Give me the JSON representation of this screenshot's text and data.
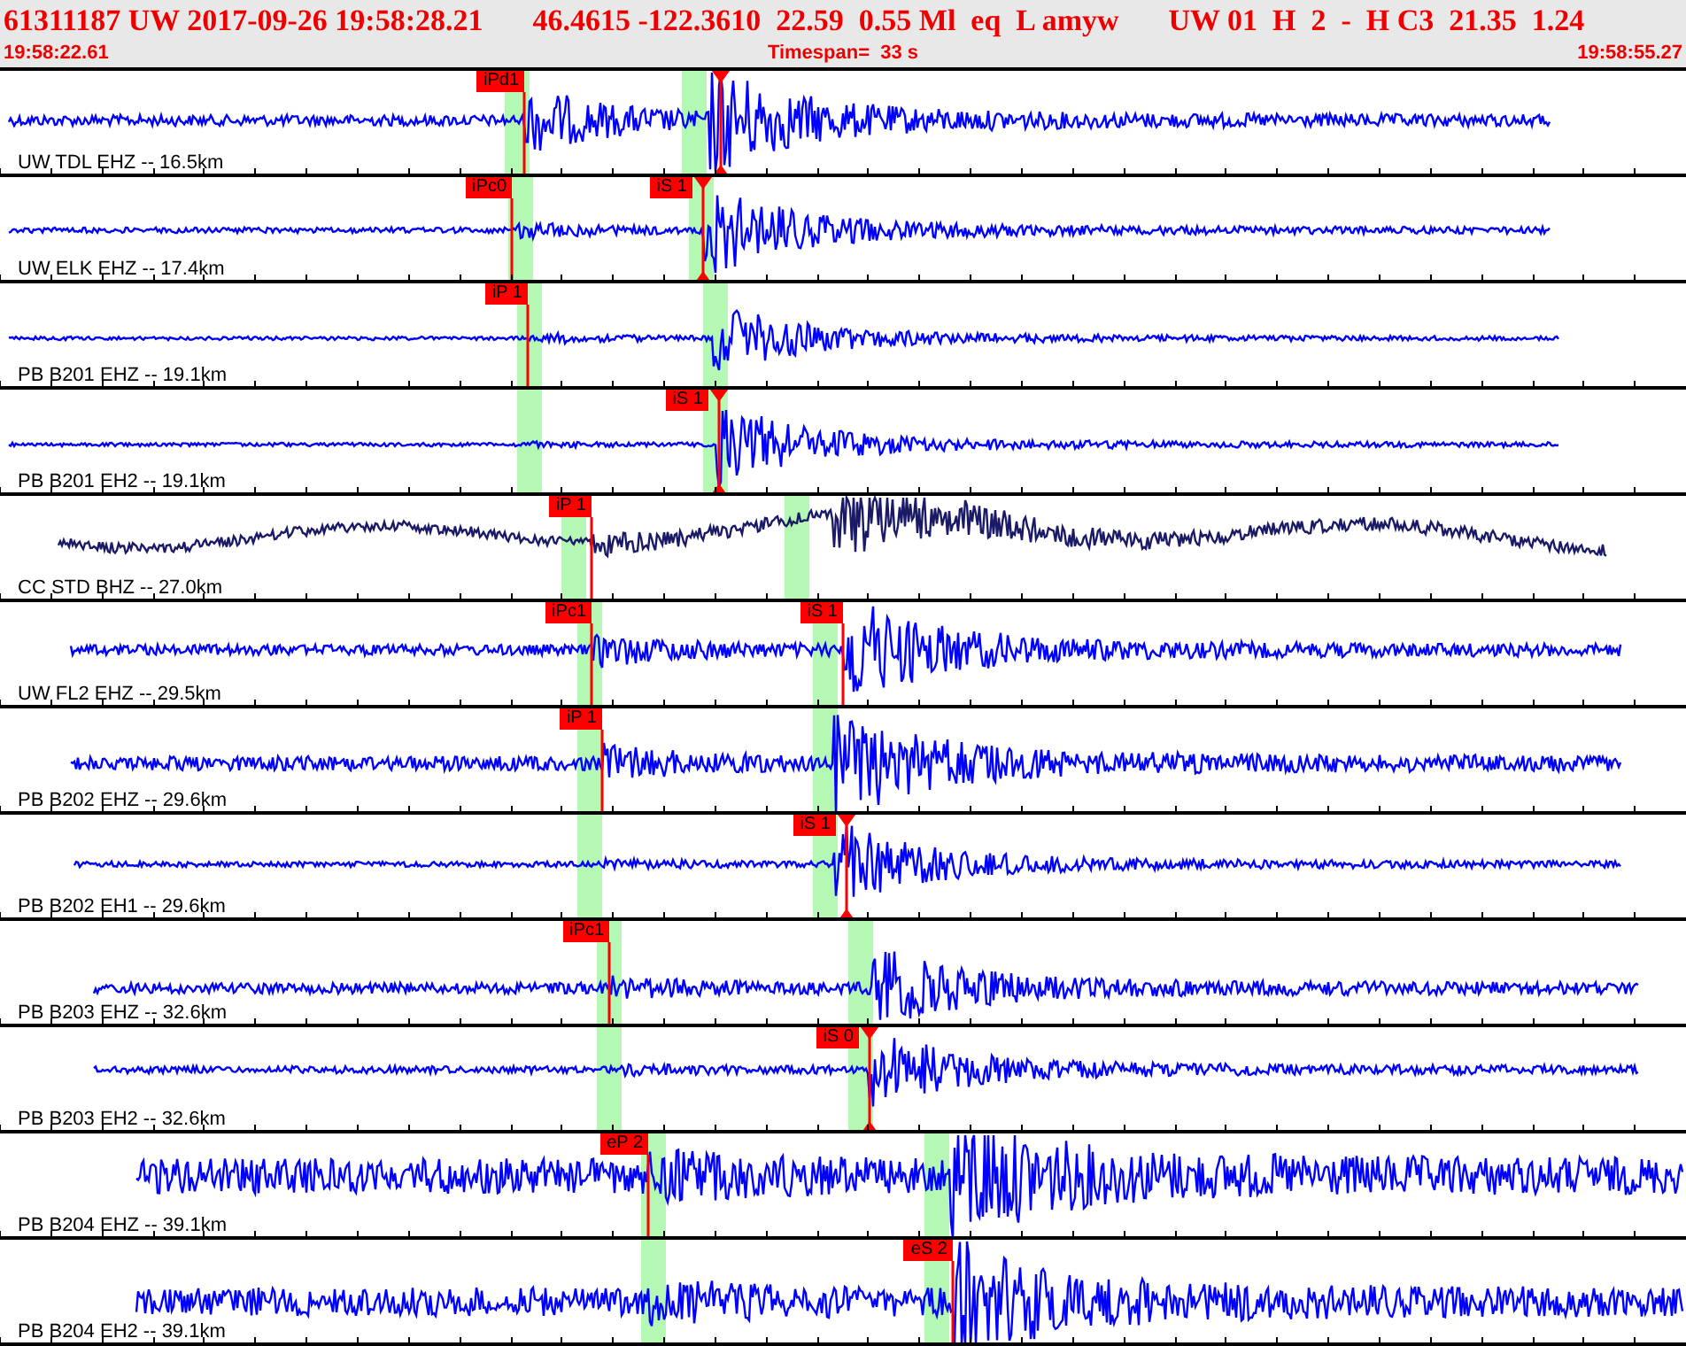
{
  "header": {
    "title_parts": [
      "61311187 UW 2017-09-26 19:58:28.21",
      "46.4615 -122.3610  22.59  0.55 Ml  eq  L amyw",
      "UW 01  H  2  -  H C3  21.35  1.24"
    ],
    "start_time": "19:58:22.61",
    "timespan": "Timespan=  33 s",
    "end_time": "19:58:55.27"
  },
  "traces": [
    {
      "label": "UW TDL EHZ -- 16.5km",
      "color": "#0000ff",
      "picks": [
        {
          "label": "iPd1",
          "selected": false
        },
        {
          "selected": true
        }
      ]
    },
    {
      "label": "UW ELK EHZ -- 17.4km",
      "color": "#0000ff",
      "picks": [
        {
          "label": "iPc0",
          "selected": false
        },
        {
          "label": "iS 1",
          "selected": true
        }
      ]
    },
    {
      "label": "PB B201 EHZ -- 19.1km",
      "color": "#0000ff",
      "picks": [
        {
          "label": "iP 1",
          "selected": false
        }
      ]
    },
    {
      "label": "PB B201 EH2 -- 19.1km",
      "color": "#0000ff",
      "picks": [
        {
          "label": "iS 1",
          "selected": true
        }
      ]
    },
    {
      "label": "CC STD BHZ -- 27.0km",
      "color": "#1a1a66",
      "picks": [
        {
          "label": "iP 1",
          "selected": false
        }
      ]
    },
    {
      "label": "UW FL2 EHZ -- 29.5km",
      "color": "#0000ff",
      "picks": [
        {
          "label": "iPc1",
          "selected": false
        },
        {
          "label": "iS 1",
          "selected": false
        }
      ]
    },
    {
      "label": "PB B202 EHZ -- 29.6km",
      "color": "#0000ff",
      "picks": [
        {
          "label": "iP 1",
          "selected": false
        }
      ]
    },
    {
      "label": "PB B202 EH1 -- 29.6km",
      "color": "#0000ff",
      "picks": [
        {
          "label": "iS 1",
          "selected": true
        }
      ]
    },
    {
      "label": "PB B203 EHZ -- 32.6km",
      "color": "#0000ff",
      "picks": [
        {
          "label": "iPc1",
          "selected": false
        }
      ]
    },
    {
      "label": "PB B203 EH2 -- 32.6km",
      "color": "#0000ff",
      "picks": [
        {
          "label": "iS 0",
          "selected": true
        }
      ]
    },
    {
      "label": "PB B204 EHZ -- 39.1km",
      "color": "#0000ff",
      "picks": [
        {
          "label": "eP 2",
          "selected": false
        }
      ]
    },
    {
      "label": "PB B204 EH2 -- 39.1km",
      "color": "#0000ff",
      "picks": [
        {
          "label": "eS 2",
          "selected": false
        }
      ]
    }
  ]
}
